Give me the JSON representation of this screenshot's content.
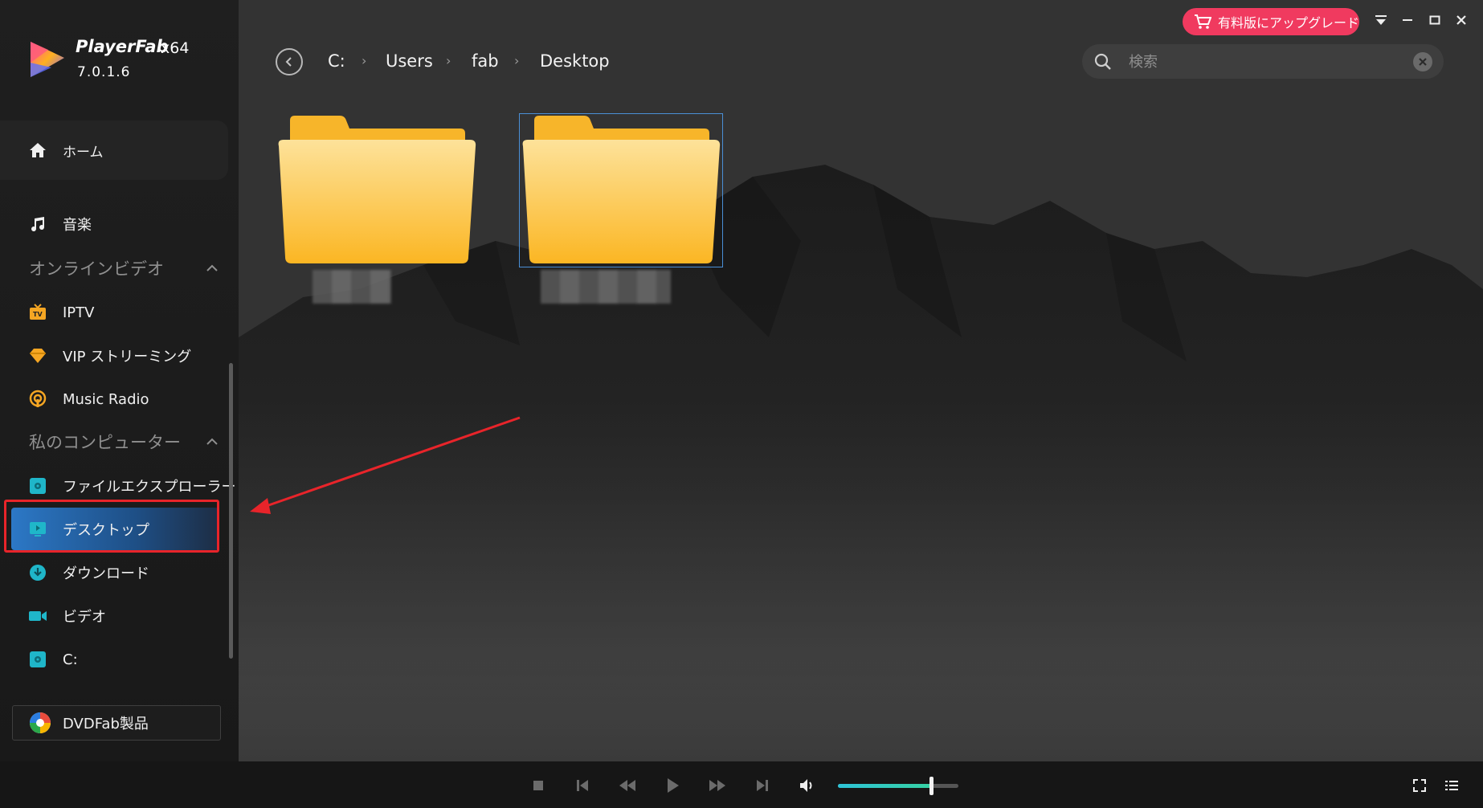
{
  "app": {
    "name": "PlayerFab",
    "arch": "x64",
    "version": "7.0.1.6"
  },
  "sidebar": {
    "home": "ホーム",
    "music": "音楽",
    "online_video": {
      "header": "オンラインビデオ",
      "items": [
        {
          "label": "IPTV",
          "icon": "tv-icon"
        },
        {
          "label": "VIP ストリーミング",
          "icon": "diamond-icon"
        },
        {
          "label": "Music Radio",
          "icon": "radio-icon"
        }
      ]
    },
    "my_computer": {
      "header": "私のコンピューター",
      "items": [
        {
          "label": "ファイルエクスプローラー",
          "icon": "disk-icon"
        },
        {
          "label": "デスクトップ",
          "icon": "desktop-icon",
          "active": true
        },
        {
          "label": "ダウンロード",
          "icon": "download-icon"
        },
        {
          "label": "ビデオ",
          "icon": "video-icon"
        },
        {
          "label": "C:",
          "icon": "disk-icon"
        }
      ]
    },
    "products_button": "DVDFab製品"
  },
  "breadcrumb": [
    "C:",
    "Users",
    "fab",
    "Desktop"
  ],
  "search": {
    "placeholder": "検索",
    "value": ""
  },
  "upgrade_button": "有料版にアップグレード",
  "folders": [
    {
      "name": "",
      "selected": false
    },
    {
      "name": "",
      "selected": true
    }
  ],
  "player": {
    "volume_fraction": 0.77
  },
  "colors": {
    "accent": "#2c78c6",
    "upgrade": "#f03a5f",
    "highlight_box": "#e8242a",
    "folder": "#fbbf2a"
  }
}
